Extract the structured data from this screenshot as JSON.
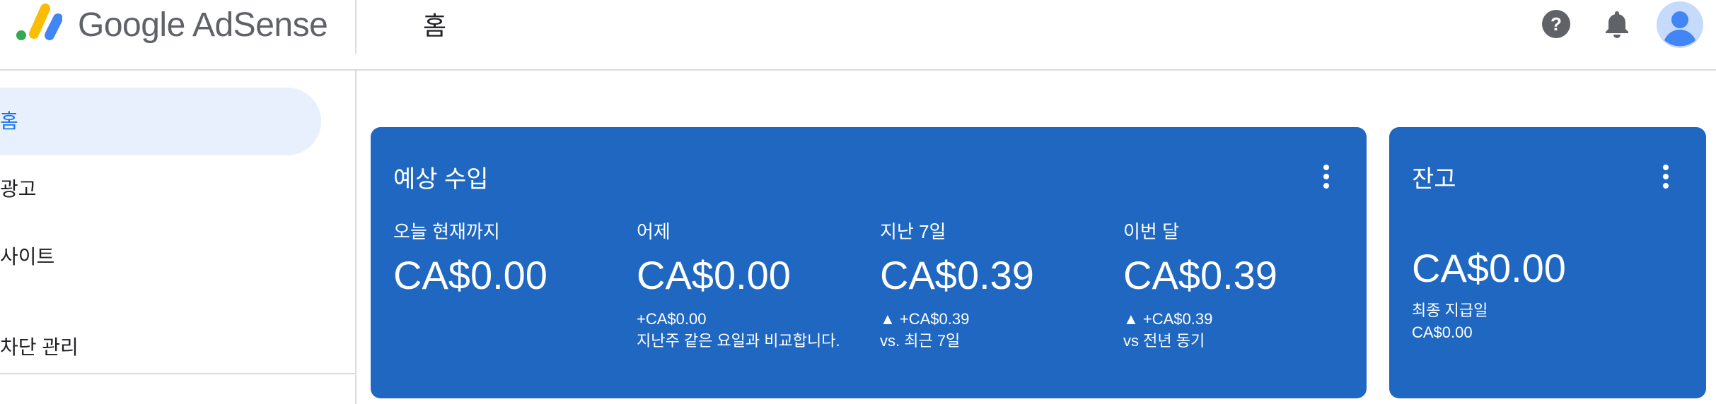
{
  "header": {
    "brand": "Google AdSense",
    "page_title": "홈",
    "icons": [
      "help-icon",
      "notifications-bell-icon",
      "account-avatar-icon"
    ],
    "colors": {
      "logo_yellow": "#fbbc04",
      "logo_green": "#34a853",
      "logo_blue": "#4285f4",
      "icon_gray": "#5f6368"
    }
  },
  "sidebar": {
    "items": [
      {
        "label": "홈",
        "active": true
      },
      {
        "label": "광고",
        "active": false
      },
      {
        "label": "사이트",
        "active": false
      },
      {
        "label": "차단 관리",
        "active": false
      }
    ],
    "active_color": "#1a73e8",
    "active_bg": "#e8f0fe"
  },
  "earnings_card": {
    "title": "예상 수입",
    "background": "#1f67c0",
    "metrics": [
      {
        "label": "오늘 현재까지",
        "value": "CA$0.00"
      },
      {
        "label": "어제",
        "value": "CA$0.00",
        "sub1": "+CA$0.00",
        "sub2": "지난주 같은 요일과 비교합니다."
      },
      {
        "label": "지난 7일",
        "value": "CA$0.39",
        "sub1": "▲ +CA$0.39",
        "sub2": "vs. 최근 7일"
      },
      {
        "label": "이번 달",
        "value": "CA$0.39",
        "sub1": "▲ +CA$0.39",
        "sub2": "vs 전년 동기"
      }
    ]
  },
  "balance_card": {
    "title": "잔고",
    "value": "CA$0.00",
    "last_payment_label": "최종 지급일",
    "last_payment_value": "CA$0.00"
  }
}
